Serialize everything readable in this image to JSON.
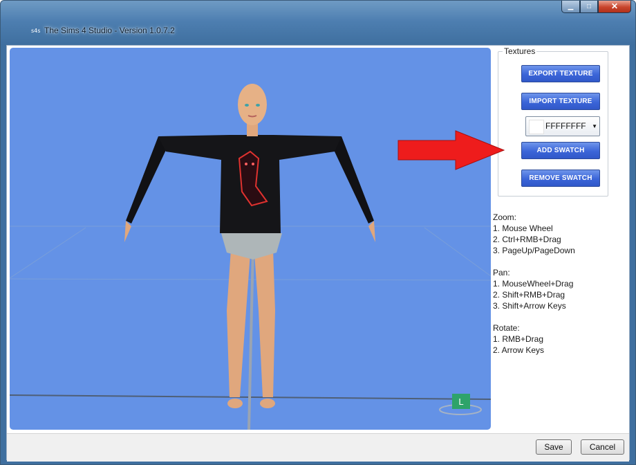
{
  "window": {
    "title": "The Sims 4 Studio - Version 1.0.7.2",
    "app_icon_text": "s4s",
    "buttons": {
      "minimize": "▁",
      "maximize": "□",
      "close": "✕"
    }
  },
  "textures_panel": {
    "group_label": "Textures",
    "export_label": "EXPORT TEXTURE",
    "import_label": "IMPORT TEXTURE",
    "color_value": "FFFFFFFF",
    "color_swatch": "#ffffff",
    "add_swatch_label": "ADD SWATCH",
    "remove_swatch_label": "REMOVE SWATCH"
  },
  "help": {
    "zoom_title": "Zoom:",
    "zoom_1": "1. Mouse Wheel",
    "zoom_2": "2. Ctrl+RMB+Drag",
    "zoom_3": "3. PageUp/PageDown",
    "pan_title": "Pan:",
    "pan_1": "1. MouseWheel+Drag",
    "pan_2": "2. Shift+RMB+Drag",
    "pan_3": "3. Shift+Arrow Keys",
    "rotate_title": "Rotate:",
    "rotate_1": "1. RMB+Drag",
    "rotate_2": "2. Arrow Keys"
  },
  "viewport": {
    "background": "#6492e6",
    "light_gizmo_label": "L"
  },
  "footer": {
    "save_label": "Save",
    "cancel_label": "Cancel"
  }
}
